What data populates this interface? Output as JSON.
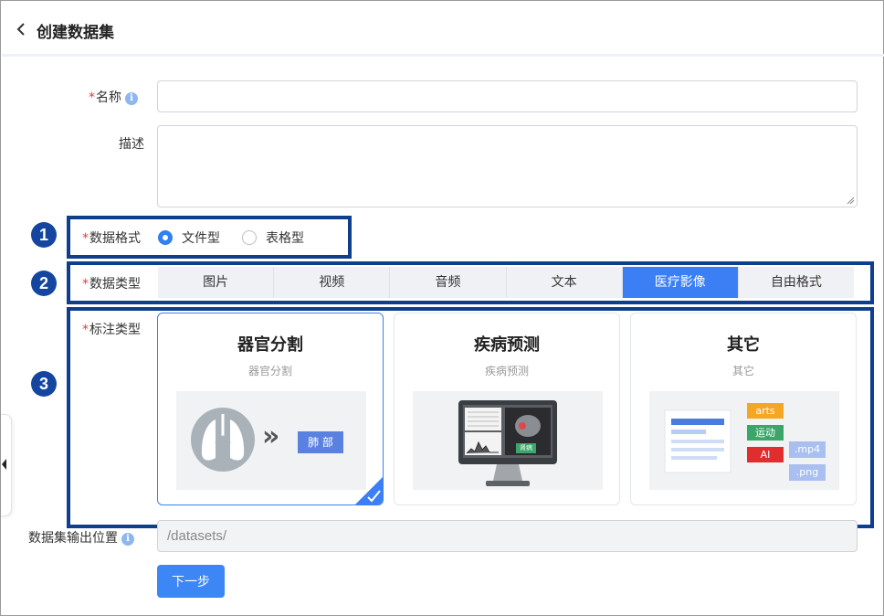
{
  "header": {
    "title": "创建数据集"
  },
  "form": {
    "name": {
      "label": "名称",
      "required": true,
      "value": ""
    },
    "description": {
      "label": "描述",
      "value": ""
    },
    "data_format": {
      "label": "数据格式",
      "required": true,
      "options": [
        {
          "label": "文件型",
          "selected": true
        },
        {
          "label": "表格型",
          "selected": false
        }
      ]
    },
    "data_type": {
      "label": "数据类型",
      "required": true,
      "tabs": [
        {
          "label": "图片",
          "active": false
        },
        {
          "label": "视频",
          "active": false
        },
        {
          "label": "音频",
          "active": false
        },
        {
          "label": "文本",
          "active": false
        },
        {
          "label": "医疗影像",
          "active": true
        },
        {
          "label": "自由格式",
          "active": false
        }
      ]
    },
    "annotation_type": {
      "label": "标注类型",
      "required": true,
      "cards": [
        {
          "title": "器官分割",
          "subtitle": "器官分割",
          "selected": true,
          "image": {
            "tag": "肺 部",
            "arrow": "»"
          }
        },
        {
          "title": "疾病预测",
          "subtitle": "疾病预测",
          "selected": false,
          "image": {
            "tag": "肾病"
          }
        },
        {
          "title": "其它",
          "subtitle": "其它",
          "selected": false,
          "image": {
            "tags": [
              "arts",
              "运动",
              "AI",
              ".mp4",
              ".png"
            ]
          }
        }
      ]
    },
    "output_location": {
      "label": "数据集输出位置",
      "value": "/datasets/"
    }
  },
  "callouts": [
    "1",
    "2",
    "3"
  ],
  "next_button": {
    "label": "下一步"
  },
  "colors": {
    "accent": "#3c7ff5",
    "callout": "#0f3e8c",
    "required": "#e8383d"
  }
}
